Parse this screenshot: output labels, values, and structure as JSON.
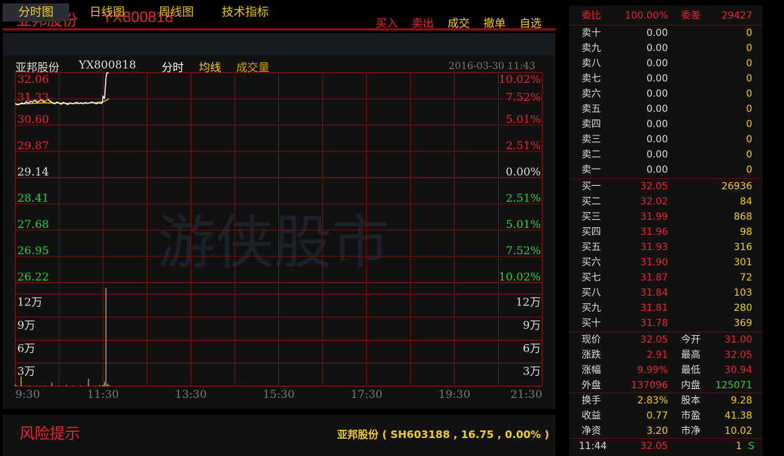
{
  "header": {
    "stock_name": "亚邦股份",
    "stock_code": "YX800818",
    "buttons": [
      {
        "label": "买入",
        "color": "#e8262d"
      },
      {
        "label": "卖出",
        "color": "#e8262d"
      },
      {
        "label": "成交",
        "color": "#f2cc12"
      },
      {
        "label": "撤单",
        "color": "#f2cc12"
      },
      {
        "label": "自选",
        "color": "#f2cc12"
      }
    ]
  },
  "tabs": [
    "分时图",
    "日线图",
    "周线图",
    "技术指标"
  ],
  "legend": {
    "name": "亚邦股份",
    "code": "YX800818",
    "mode": "分时",
    "avg": "均线",
    "volume": "成交量",
    "datetime": "2016-03-30 11:43"
  },
  "watermark": "游侠股市",
  "chart_data": {
    "type": "line",
    "price_ticks": [
      "32.06",
      "31.33",
      "30.60",
      "29.87",
      "29.14",
      "28.41",
      "27.68",
      "26.95",
      "26.22"
    ],
    "pct_ticks": [
      "10.02%",
      "7.52%",
      "5.01%",
      "2.51%",
      "0.00%",
      "2.51%",
      "5.01%",
      "7.52%",
      "10.02%"
    ],
    "price_range": [
      26.22,
      32.06
    ],
    "prev_close": 29.14,
    "volume_ticks": [
      "12万",
      "9万",
      "6万",
      "3万"
    ],
    "volume_range": [
      0,
      135000
    ],
    "time_ticks": [
      "9:30",
      "11:30",
      "13:30",
      "15:30",
      "17:30",
      "19:30",
      "21:30"
    ],
    "price_series": [
      {
        "t": 0,
        "v": 31.2
      },
      {
        "t": 3,
        "v": 31.16
      },
      {
        "t": 6,
        "v": 31.18
      },
      {
        "t": 9,
        "v": 31.22
      },
      {
        "t": 12,
        "v": 31.19
      },
      {
        "t": 15,
        "v": 31.25
      },
      {
        "t": 18,
        "v": 31.21
      },
      {
        "t": 21,
        "v": 31.26
      },
      {
        "t": 24,
        "v": 31.24
      },
      {
        "t": 27,
        "v": 31.29
      },
      {
        "t": 30,
        "v": 31.23
      },
      {
        "t": 33,
        "v": 31.27
      },
      {
        "t": 36,
        "v": 31.3
      },
      {
        "t": 39,
        "v": 31.25
      },
      {
        "t": 42,
        "v": 31.28
      },
      {
        "t": 45,
        "v": 31.31
      },
      {
        "t": 48,
        "v": 31.26
      },
      {
        "t": 51,
        "v": 31.22
      },
      {
        "t": 54,
        "v": 31.19
      },
      {
        "t": 57,
        "v": 31.24
      },
      {
        "t": 60,
        "v": 31.21
      },
      {
        "t": 63,
        "v": 31.18
      },
      {
        "t": 66,
        "v": 31.23
      },
      {
        "t": 69,
        "v": 31.2
      },
      {
        "t": 72,
        "v": 31.17
      },
      {
        "t": 75,
        "v": 31.22
      },
      {
        "t": 78,
        "v": 31.19
      },
      {
        "t": 81,
        "v": 31.21
      },
      {
        "t": 84,
        "v": 31.23
      },
      {
        "t": 87,
        "v": 31.2
      },
      {
        "t": 90,
        "v": 31.22
      },
      {
        "t": 93,
        "v": 31.19
      },
      {
        "t": 96,
        "v": 31.23
      },
      {
        "t": 99,
        "v": 31.2
      },
      {
        "t": 102,
        "v": 31.22
      },
      {
        "t": 105,
        "v": 31.24
      },
      {
        "t": 108,
        "v": 31.21
      },
      {
        "t": 111,
        "v": 31.19
      },
      {
        "t": 114,
        "v": 31.22
      },
      {
        "t": 117,
        "v": 31.2
      },
      {
        "t": 119,
        "v": 31.22
      },
      {
        "t": 120,
        "v": 31.4
      },
      {
        "t": 122,
        "v": 31.35
      },
      {
        "t": 124,
        "v": 31.9
      },
      {
        "t": 125,
        "v": 32.05
      },
      {
        "t": 128,
        "v": 32.05
      }
    ],
    "avg_series": [
      {
        "t": 0,
        "v": 31.18
      },
      {
        "t": 20,
        "v": 31.2
      },
      {
        "t": 40,
        "v": 31.22
      },
      {
        "t": 60,
        "v": 31.21
      },
      {
        "t": 80,
        "v": 31.2
      },
      {
        "t": 100,
        "v": 31.21
      },
      {
        "t": 120,
        "v": 31.24
      },
      {
        "t": 128,
        "v": 31.33
      }
    ],
    "volume_series": [
      {
        "t": 0,
        "v": 2200
      },
      {
        "t": 2,
        "v": 900
      },
      {
        "t": 8,
        "v": 12500
      },
      {
        "t": 14,
        "v": 600
      },
      {
        "t": 20,
        "v": 800
      },
      {
        "t": 30,
        "v": 500
      },
      {
        "t": 40,
        "v": 700
      },
      {
        "t": 50,
        "v": 4600
      },
      {
        "t": 60,
        "v": 600
      },
      {
        "t": 70,
        "v": 1500
      },
      {
        "t": 80,
        "v": 500
      },
      {
        "t": 90,
        "v": 800
      },
      {
        "t": 100,
        "v": 9700
      },
      {
        "t": 110,
        "v": 600
      },
      {
        "t": 115,
        "v": 1400
      },
      {
        "t": 119,
        "v": 700
      },
      {
        "t": 120,
        "v": 1800
      },
      {
        "t": 122,
        "v": 6000
      },
      {
        "t": 124,
        "v": 128000
      },
      {
        "t": 126,
        "v": 3000
      },
      {
        "t": 128,
        "v": 2000
      }
    ],
    "total_minutes": 720
  },
  "quote": {
    "weibi_label": "委比",
    "weibi": "100.00%",
    "weicha_label": "委差",
    "weicha": "29427",
    "sell": [
      {
        "label": "卖十",
        "price": "0.00",
        "vol": "0"
      },
      {
        "label": "卖九",
        "price": "0.00",
        "vol": "0"
      },
      {
        "label": "卖八",
        "price": "0.00",
        "vol": "0"
      },
      {
        "label": "卖七",
        "price": "0.00",
        "vol": "0"
      },
      {
        "label": "卖六",
        "price": "0.00",
        "vol": "0"
      },
      {
        "label": "卖五",
        "price": "0.00",
        "vol": "0"
      },
      {
        "label": "卖四",
        "price": "0.00",
        "vol": "0"
      },
      {
        "label": "卖三",
        "price": "0.00",
        "vol": "0"
      },
      {
        "label": "卖二",
        "price": "0.00",
        "vol": "0"
      },
      {
        "label": "卖一",
        "price": "0.00",
        "vol": "0"
      }
    ],
    "buy": [
      {
        "label": "买一",
        "price": "32.05",
        "vol": "26936"
      },
      {
        "label": "买二",
        "price": "32.02",
        "vol": "84"
      },
      {
        "label": "买三",
        "price": "31.99",
        "vol": "868"
      },
      {
        "label": "买四",
        "price": "31.96",
        "vol": "98"
      },
      {
        "label": "买五",
        "price": "31.93",
        "vol": "316"
      },
      {
        "label": "买六",
        "price": "31.90",
        "vol": "301"
      },
      {
        "label": "买七",
        "price": "31.87",
        "vol": "72"
      },
      {
        "label": "买八",
        "price": "31.84",
        "vol": "103"
      },
      {
        "label": "买九",
        "price": "31.81",
        "vol": "280"
      },
      {
        "label": "买十",
        "price": "31.78",
        "vol": "369"
      }
    ],
    "stats": [
      {
        "l1": "现价",
        "v1": "32.05",
        "c1": "#e8262d",
        "l2": "今开",
        "v2": "31.00",
        "c2": "#e8262d"
      },
      {
        "l1": "涨跌",
        "v1": "2.91",
        "c1": "#e8262d",
        "l2": "最高",
        "v2": "32.05",
        "c2": "#e8262d"
      },
      {
        "l1": "涨幅",
        "v1": "9.99%",
        "c1": "#e8262d",
        "l2": "最低",
        "v2": "30.94",
        "c2": "#e8262d"
      },
      {
        "l1": "外盘",
        "v1": "137096",
        "c1": "#e8262d",
        "l2": "内盘",
        "v2": "125071",
        "c2": "#2ecc40"
      }
    ],
    "stats2": [
      {
        "l1": "换手",
        "v1": "2.83%",
        "c1": "#f2cc12",
        "l2": "股本",
        "v2": "9.28",
        "c2": "#f2cc12"
      },
      {
        "l1": "收益",
        "v1": "0.77",
        "c1": "#f2cc12",
        "l2": "市盈",
        "v2": "41.38",
        "c2": "#f2cc12"
      },
      {
        "l1": "净资",
        "v1": "3.20",
        "c1": "#f2cc12",
        "l2": "市净",
        "v2": "10.02",
        "c2": "#f2cc12"
      }
    ],
    "tick": {
      "time": "11:44",
      "price": "32.05",
      "vol": "1",
      "side": "S"
    }
  },
  "footer": {
    "risk_title": "风险提示",
    "stock_info": "亚邦股份 ( SH603188 , 16.75 , 0.00% )"
  }
}
